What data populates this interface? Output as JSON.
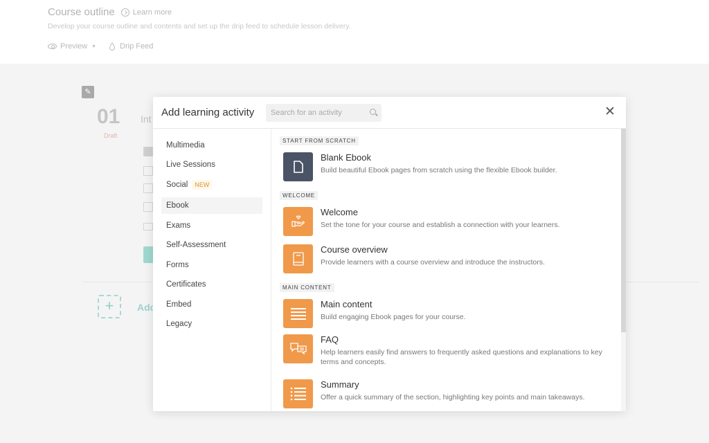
{
  "page": {
    "title": "Course outline",
    "learn_more": "Learn more",
    "subtitle": "Develop your course outline and contents and set up the drip feed to schedule lesson delivery.",
    "actions": {
      "preview": "Preview",
      "drip_feed": "Drip Feed"
    }
  },
  "section": {
    "number": "01",
    "status": "Draft",
    "name": "Int",
    "add_label": "Add"
  },
  "modal": {
    "title": "Add learning activity",
    "search_placeholder": "Search for an activity",
    "close_icon": "close-icon",
    "categories": [
      {
        "label": "Multimedia"
      },
      {
        "label": "Live Sessions"
      },
      {
        "label": "Social",
        "badge": "NEW"
      },
      {
        "label": "Ebook",
        "active": true
      },
      {
        "label": "Exams"
      },
      {
        "label": "Self-Assessment"
      },
      {
        "label": "Forms"
      },
      {
        "label": "Certificates"
      },
      {
        "label": "Embed"
      },
      {
        "label": "Legacy"
      }
    ],
    "groups": [
      {
        "label": "START FROM SCRATCH",
        "items": [
          {
            "title": "Blank Ebook",
            "desc": "Build beautiful Ebook pages from scratch using the flexible Ebook builder.",
            "icon": "blank-page-icon",
            "color": "#4b5366"
          }
        ]
      },
      {
        "label": "WELCOME",
        "items": [
          {
            "title": "Welcome",
            "desc": "Set the tone for your course and establish a connection with your learners.",
            "icon": "hand-heart-icon",
            "color": "#f0994a"
          },
          {
            "title": "Course overview",
            "desc": "Provide learners with a course overview and introduce the instructors.",
            "icon": "book-icon",
            "color": "#f0994a"
          }
        ]
      },
      {
        "label": "MAIN CONTENT",
        "items": [
          {
            "title": "Main content",
            "desc": "Build engaging Ebook pages for your course.",
            "icon": "text-lines-icon",
            "color": "#f0994a"
          },
          {
            "title": "FAQ",
            "desc": "Help learners easily find answers to frequently asked questions and explanations to key terms and concepts.",
            "icon": "chat-bubbles-icon",
            "color": "#f0994a"
          },
          {
            "title": "Summary",
            "desc": "Offer a quick summary of the section, highlighting key points and main takeaways.",
            "icon": "bulleted-list-icon",
            "color": "#f0994a"
          }
        ]
      }
    ]
  },
  "colors": {
    "accent_orange": "#f0994a",
    "dark_icon": "#4b5366",
    "teal": "#9fd8d0"
  }
}
